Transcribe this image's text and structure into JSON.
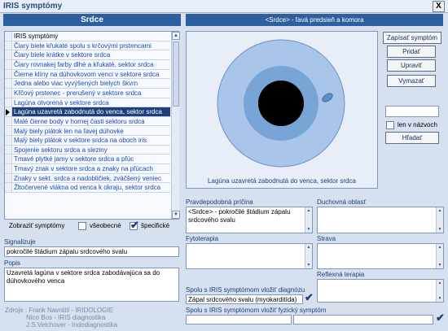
{
  "window": {
    "title": "IRIS symptómy",
    "close_label": "X"
  },
  "left_header": "Srdce",
  "right_header": "<Srdce> - ľavá predsieň a komora",
  "list": {
    "header": "IRIS symptómy",
    "items": [
      "Čiary biele křukaté spolu s krčovými prstencami",
      "Čiary biele krátke v sektore srdca",
      "Čiary rovnakej farby dlhé a křukaté, sektor srdca",
      "Čierne klíny na dúhovkovom venci v sektore srdca",
      "Jedna alebo viac vyvýšených bielych škvrn",
      "Křčový prstenec - prerušený v sektore srdca",
      "Lagúna otvorená v sektore srdca",
      "Lagúna uzavretá zabodnutá do venca, sektor srdca",
      "Malé čierne body v hornej časti sektoru srdca",
      "Malý biely plátok len na ľavej dúhovke",
      "Malý biely plátok v sektore srdca na oboch iris",
      "Spojenie sektoru srdca a sleziny",
      "Tmavé plytké jamy v sektore srdca a pľúc",
      "Tmavý znak v sektore srdca a znaky na pľúcach",
      "Znaky v sekt. srdca a nadobličiek, zväčšený veniec",
      "Žltočervené vlákna od venca k okraju, sektor srdca"
    ],
    "selected_index": 7,
    "scroll_up": "▲",
    "scroll_down": "▼"
  },
  "filters": {
    "label": "Zobraziť symptómy",
    "general": {
      "label": "všeobecné",
      "checked": false
    },
    "specific": {
      "label": "špecifické",
      "checked": true
    }
  },
  "signalizuje": {
    "label": "Signalizuje",
    "value": "pokročilé štádium zápalu srdcového svalu"
  },
  "popis": {
    "label": "Popis",
    "value": "Uzavretá lagúna v sektore srdca zabodávajúca sa do dúhovkového venca"
  },
  "source": {
    "lines": [
      "Zdroje : Frank Navrátil - IRIDOLOGIE",
      "Nico Bos - IRIS diagnostika",
      "J.S.Velchover - Iridodiagnostika"
    ]
  },
  "iris": {
    "caption": "Lagúna uzavretá zabodnutá do venca, sektor srdca"
  },
  "buttons": {
    "save": "Zapísať symptóm",
    "add": "Pridať",
    "edit": "Upraviť",
    "delete": "Vymazať",
    "search": "Hľadať"
  },
  "search": {
    "value": "",
    "only_names_label": "len v názvoch",
    "only_names_checked": false
  },
  "fields": {
    "cause": {
      "label": "Pravdepodobná príčina",
      "value": "<Srdce> - pokročilé štádium zápalu srdcového svalu"
    },
    "spiritual": {
      "label": "Duchovná oblasť",
      "value": ""
    },
    "phyto": {
      "label": "Fytoterapia",
      "value": ""
    },
    "diet": {
      "label": "Strava",
      "value": ""
    },
    "reflex": {
      "label": "Reflexná terapia",
      "value": ""
    },
    "diagnosis": {
      "label": "Spolu s IRIS symptómom vložiť diagnózu",
      "value": "Zápal srdcového svalu (myokarditída)"
    },
    "physical": {
      "label": "Spolu s IRIS symptómom vložiť fyzický symptóm",
      "value_left": "",
      "value_right": ""
    }
  },
  "icons": {
    "checkmark": "✔"
  },
  "colors": {
    "background": "#d6e0ee",
    "header": "#2d5fa0",
    "selected_row": "#1f3f7a",
    "link_text": "#1f48b5",
    "iris_outer": "#a9c6ea",
    "iris_inner": "#78a5d6",
    "pupil": "#000000"
  }
}
